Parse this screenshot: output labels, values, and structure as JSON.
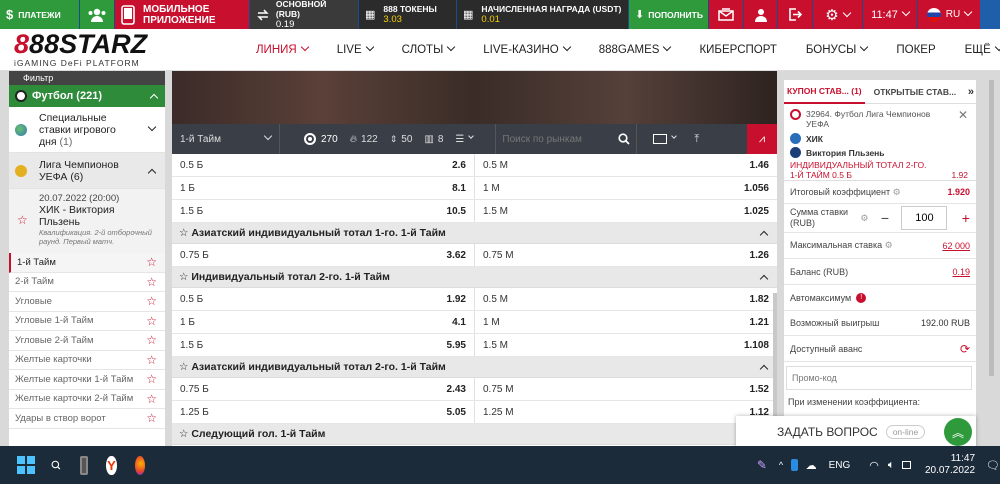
{
  "topbar": {
    "payments": "ПЛАТЕЖИ",
    "mobile_app_1": "МОБИЛЬНОЕ",
    "mobile_app_2": "ПРИЛОЖЕНИЕ",
    "main_label": "ОСНОВНОЙ (RUB)",
    "main_value": "0.19",
    "tokens_label": "888 ТОКЕНЫ",
    "tokens_value": "3.03",
    "reward_label": "НАЧИСЛЕННАЯ НАГРАДА (USDT)",
    "reward_value": "0.01",
    "deposit": "ПОПОЛНИТЬ",
    "time": "11:47",
    "lang": "RU"
  },
  "logo": {
    "main_a": "8",
    "main_b": "8",
    "main_c": "8STARZ",
    "sub": "iGAMING DeFi PLATFORM"
  },
  "nav": {
    "items": [
      "ЛИНИЯ",
      "LIVE",
      "СЛОТЫ",
      "LIVE-КАЗИНО",
      "888GAMES",
      "КИБЕРСПОРТ",
      "БОНУСЫ",
      "ПОКЕР",
      "ЕЩЁ"
    ]
  },
  "sidebar": {
    "filter": "Фильтр",
    "sport": "Футбол (221)",
    "special_1": "Специальные",
    "special_2": "ставки игрового",
    "special_3": "дня",
    "special_count": "(1)",
    "league_1": "Лига Чемпионов",
    "league_2": "УЕФА",
    "league_count": "(6)",
    "match_date": "20.07.2022 (20:00)",
    "match_teams_1": "ХИК - Виктория",
    "match_teams_2": "Пльзень",
    "match_info_1": "Квалификация. 2-й отборочный",
    "match_info_2": "раунд. Первый матч.",
    "items": [
      "1-й Тайм",
      "2-й Тайм",
      "Угловые",
      "Угловые 1-й Тайм",
      "Угловые 2-й Тайм",
      "Желтые карточки",
      "Желтые карточки 1-й Тайм",
      "Желтые карточки 2-й Тайм",
      "Удары в створ ворот"
    ]
  },
  "toolbar": {
    "period": "1-й Тайм",
    "count_all": "270",
    "count_fire": "122",
    "count_updown": "50",
    "count_col": "8",
    "search_placeholder": "Поиск по рынкам"
  },
  "markets": {
    "top_rows": [
      {
        "l": "0.5 Б",
        "lv": "2.6",
        "r": "0.5 М",
        "rv": "1.46"
      },
      {
        "l": "1 Б",
        "lv": "8.1",
        "r": "1 М",
        "rv": "1.056"
      },
      {
        "l": "1.5 Б",
        "lv": "10.5",
        "r": "1.5 М",
        "rv": "1.025"
      }
    ],
    "sections": [
      {
        "title": "Азиатский индивидуальный тотал 1-го. 1-й Тайм",
        "rows": [
          {
            "l": "0.75 Б",
            "lv": "3.62",
            "r": "0.75 М",
            "rv": "1.26"
          }
        ]
      },
      {
        "title": "Индивидуальный тотал 2-го. 1-й Тайм",
        "rows": [
          {
            "l": "0.5 Б",
            "lv": "1.92",
            "r": "0.5 М",
            "rv": "1.82"
          },
          {
            "l": "1 Б",
            "lv": "4.1",
            "r": "1 М",
            "rv": "1.21"
          },
          {
            "l": "1.5 Б",
            "lv": "5.95",
            "r": "1.5 М",
            "rv": "1.108"
          }
        ]
      },
      {
        "title": "Азиатский индивидуальный тотал 2-го. 1-й Тайм",
        "rows": [
          {
            "l": "0.75 Б",
            "lv": "2.43",
            "r": "0.75 М",
            "rv": "1.52"
          },
          {
            "l": "1.25 Б",
            "lv": "5.05",
            "r": "1.25 М",
            "rv": "1.12"
          }
        ]
      },
      {
        "title": "Следующий гол. 1-й Тайм",
        "rows": []
      }
    ]
  },
  "coupon": {
    "tab1": "КУПОН СТАВ...",
    "tab1_count": "(1)",
    "tab2": "ОТКРЫТЫЕ СТАВ...",
    "bet_event": "32964. Футбол Лига Чемпионов УЕФА",
    "team1": "ХИК",
    "team2": "Виктория Пльзень",
    "bet_market_1": "ИНДИВИДУАЛЬНЫЙ ТОТАЛ 2-ГО.",
    "bet_market_2": "1-Й ТАЙМ 0.5 Б",
    "bet_odd": "1.92",
    "total_coef_label": "Итоговый коэффициент",
    "total_coef": "1.920",
    "stake_label_1": "Сумма ставки",
    "stake_label_2": "(RUB)",
    "stake_value": "100",
    "max_stake_label": "Максимальная ставка",
    "max_stake": "62 000",
    "balance_label": "Баланс (RUB)",
    "balance": "0.19",
    "automax_label": "Автомаксимум",
    "possible_win_label": "Возможный выигрыш",
    "possible_win": "192.00 RUB",
    "advance_label": "Доступный аванс",
    "promo_placeholder": "Промо-код",
    "on_change": "При изменении коэффициента:"
  },
  "chat": {
    "label": "ЗАДАТЬ ВОПРОС",
    "status": "on-line"
  },
  "taskbar": {
    "lang": "ENG",
    "time": "11:47",
    "date": "20.07.2022"
  },
  "colors": {
    "brand_red": "#c8102e",
    "top_blue": "#1f5ea8",
    "green": "#2e8b3a"
  }
}
